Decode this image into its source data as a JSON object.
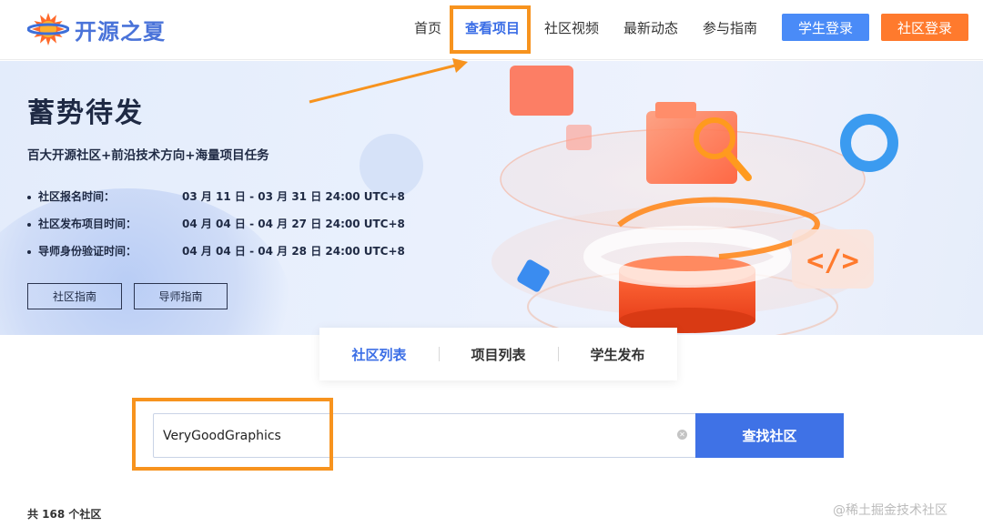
{
  "header": {
    "logo_text": "开源之夏",
    "nav": [
      "首页",
      "查看项目",
      "社区视频",
      "最新动态",
      "参与指南"
    ],
    "active_nav": "查看项目",
    "student_login": "学生登录",
    "community_login": "社区登录"
  },
  "banner": {
    "title": "蓄势待发",
    "subtitle": "百大开源社区+前沿技术方向+海量项目任务",
    "schedule": [
      {
        "label": "社区报名时间：",
        "value": "03 月 11 日 - 03 月 31 日 24:00 UTC+8"
      },
      {
        "label": "社区发布项目时间：",
        "value": "04 月 04 日 - 04 月 27 日 24:00 UTC+8"
      },
      {
        "label": "导师身份验证时间：",
        "value": "04 月 04 日 - 04 月 28 日 24:00 UTC+8"
      }
    ],
    "buttons": [
      "社区指南",
      "导师指南"
    ]
  },
  "tabs": {
    "items": [
      "社区列表",
      "项目列表",
      "学生发布"
    ],
    "active": "社区列表"
  },
  "search": {
    "value": "VeryGoodGraphics",
    "button": "查找社区"
  },
  "count_text": "共 168 个社区",
  "watermark": "@稀土掘金技术社区",
  "colors": {
    "brand_blue": "#3f72e6",
    "community_orange": "#ff7a2d",
    "annotation_orange": "#f7931e"
  }
}
